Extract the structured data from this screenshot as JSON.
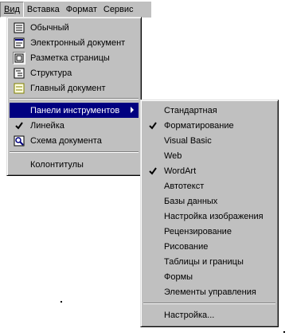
{
  "menubar": {
    "items": [
      "Вид",
      "Вставка",
      "Формат",
      "Сервис"
    ]
  },
  "view_menu": {
    "items": [
      {
        "label": "Обычный",
        "icon": "normal-view-icon"
      },
      {
        "label": "Электронный документ",
        "icon": "web-layout-icon"
      },
      {
        "label": "Разметка страницы",
        "icon": "page-layout-icon"
      },
      {
        "label": "Структура",
        "icon": "outline-icon"
      },
      {
        "label": "Главный документ",
        "icon": "master-document-icon"
      },
      {
        "label": "Панели инструментов",
        "icon": "",
        "submenu": true,
        "highlighted": true
      },
      {
        "label": "Линейка",
        "icon": "checkmark-icon",
        "checked": true
      },
      {
        "label": "Схема документа",
        "icon": "document-map-icon"
      },
      {
        "label": "Колонтитулы",
        "icon": ""
      }
    ]
  },
  "toolbars_menu": {
    "items": [
      {
        "label": "Стандартная",
        "checked": false
      },
      {
        "label": "Форматирование",
        "checked": true
      },
      {
        "label": "Visual Basic",
        "checked": false
      },
      {
        "label": "Web",
        "checked": false
      },
      {
        "label": "WordArt",
        "checked": true
      },
      {
        "label": "Автотекст",
        "checked": false
      },
      {
        "label": "Базы данных",
        "checked": false
      },
      {
        "label": "Настройка изображения",
        "checked": false
      },
      {
        "label": "Рецензирование",
        "checked": false
      },
      {
        "label": "Рисование",
        "checked": false
      },
      {
        "label": "Таблицы и границы",
        "checked": false
      },
      {
        "label": "Формы",
        "checked": false
      },
      {
        "label": "Элементы управления",
        "checked": false
      },
      {
        "label": "Настройка...",
        "checked": false
      }
    ]
  },
  "colors": {
    "menu_bg": "#c0c0c0",
    "highlight": "#000080"
  }
}
